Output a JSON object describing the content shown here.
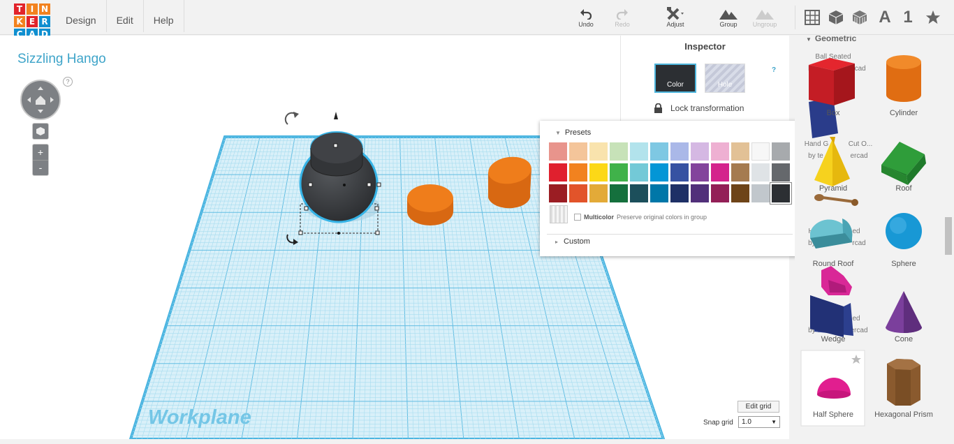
{
  "logo": {
    "letters": [
      "T",
      "I",
      "N",
      "K",
      "E",
      "R",
      "C",
      "A",
      "D"
    ]
  },
  "menu": {
    "items": [
      "Design",
      "Edit",
      "Help"
    ]
  },
  "toolbar": {
    "undo": "Undo",
    "redo": "Redo",
    "adjust": "Adjust",
    "group": "Group",
    "ungroup": "Ungroup"
  },
  "view": {
    "text_tool": "A",
    "number_tool": "1"
  },
  "project": {
    "title": "Sizzling Hango"
  },
  "workplane": {
    "label": "Workplane",
    "edit_grid": "Edit grid",
    "snap_grid_label": "Snap grid",
    "snap_grid_value": "1.0"
  },
  "inspector": {
    "title": "Inspector",
    "color_label": "Color",
    "hole_label": "Hole",
    "help": "?",
    "lock_label": "Lock transformation"
  },
  "colors": {
    "presets_label": "Presets",
    "multicolor_label": "Multicolor",
    "multicolor_desc": "Preserve original colors in group",
    "custom_label": "Custom",
    "rows": [
      [
        "#e8948c",
        "#f4c59a",
        "#f9e3ad",
        "#c7e2b8",
        "#b2e3ec",
        "#7ec8e3",
        "#aab8e8",
        "#d5b8e3",
        "#eeb0d2",
        "#e2c196",
        "#f7f7f7",
        "#a7aaad"
      ],
      [
        "#e0202e",
        "#f2821f",
        "#fcd817",
        "#40b24a",
        "#73c9d7",
        "#0396d6",
        "#3652a2",
        "#83449c",
        "#d4238c",
        "#a57b50",
        "#dfe3e6",
        "#65686c"
      ],
      [
        "#9b1d23",
        "#e2542a",
        "#e3aa38",
        "#15703d",
        "#1c4f5b",
        "#0077a8",
        "#1e3066",
        "#51307a",
        "#931f57",
        "#6e4418",
        "#c1c7cc",
        "#2c2f33"
      ]
    ]
  },
  "sidebar": {
    "category": "Geometric",
    "shapes": [
      "Box",
      "Cylinder",
      "Pyramid",
      "Roof",
      "Round Roof",
      "Sphere",
      "Wedge",
      "Cone",
      "Half Sphere",
      "Hexagonal Prism"
    ],
    "ghost_texts": [
      "Ball Seated",
      "by te",
      "rcad",
      "Hand G",
      "Cut O...",
      "by te",
      "ercad",
      "H",
      "ed",
      "by te",
      "rcad",
      "ed",
      "by te",
      "ercad"
    ]
  },
  "accent": "#3ea4c9"
}
